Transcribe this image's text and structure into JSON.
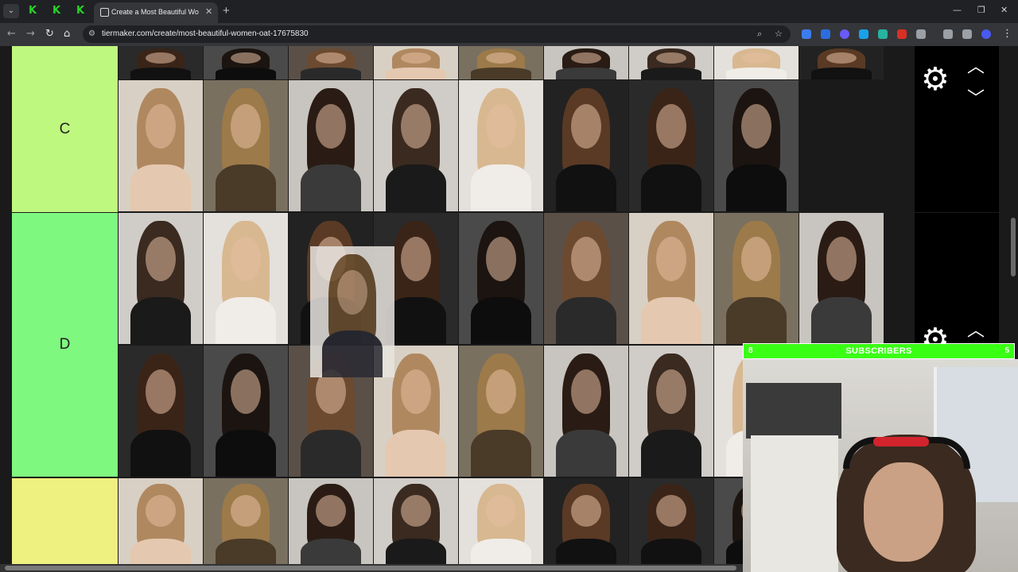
{
  "browser": {
    "pinned_tab_glyph": "K",
    "active_tab_title": "Create a Most Beautiful Women",
    "url": "tiermaker.com/create/most-beautiful-women-oat-17675830",
    "extension_colors": [
      "#3b7ded",
      "#2b6de0",
      "#6a5af9",
      "#1aa0e8",
      "#d93025",
      "#9aa0a6"
    ]
  },
  "tiers": [
    {
      "label": "C",
      "color": "#bef87f"
    },
    {
      "label": "D",
      "color": "#7ff87f"
    },
    {
      "label": "",
      "color": "#eef07f"
    }
  ],
  "controls": {
    "gear_icon": "gear-icon",
    "up_icon": "chevron-up-icon",
    "down_icon": "chevron-down-icon"
  },
  "overlay": {
    "subscriber_left": "8",
    "subscriber_label": "SUBSCRIBERS",
    "subscriber_right": "5",
    "bar_color": "#39ff14"
  }
}
